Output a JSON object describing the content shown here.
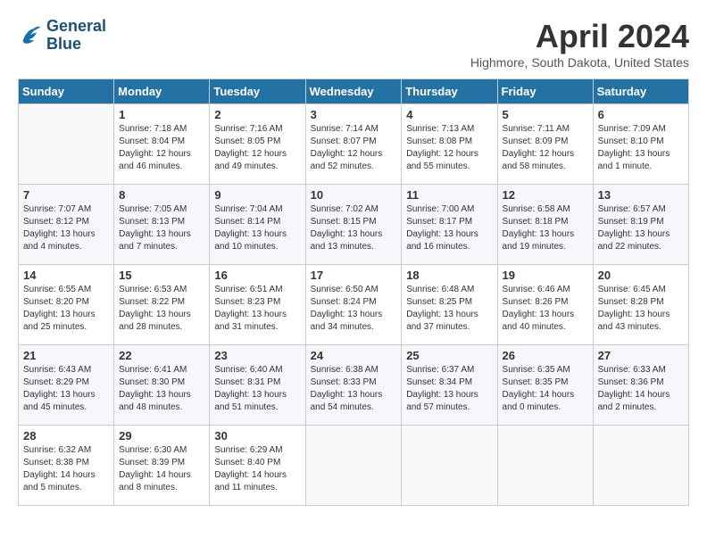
{
  "header": {
    "logo_line1": "General",
    "logo_line2": "Blue",
    "month_title": "April 2024",
    "subtitle": "Highmore, South Dakota, United States"
  },
  "weekdays": [
    "Sunday",
    "Monday",
    "Tuesday",
    "Wednesday",
    "Thursday",
    "Friday",
    "Saturday"
  ],
  "weeks": [
    [
      {
        "day": "",
        "info": ""
      },
      {
        "day": "1",
        "info": "Sunrise: 7:18 AM\nSunset: 8:04 PM\nDaylight: 12 hours\nand 46 minutes."
      },
      {
        "day": "2",
        "info": "Sunrise: 7:16 AM\nSunset: 8:05 PM\nDaylight: 12 hours\nand 49 minutes."
      },
      {
        "day": "3",
        "info": "Sunrise: 7:14 AM\nSunset: 8:07 PM\nDaylight: 12 hours\nand 52 minutes."
      },
      {
        "day": "4",
        "info": "Sunrise: 7:13 AM\nSunset: 8:08 PM\nDaylight: 12 hours\nand 55 minutes."
      },
      {
        "day": "5",
        "info": "Sunrise: 7:11 AM\nSunset: 8:09 PM\nDaylight: 12 hours\nand 58 minutes."
      },
      {
        "day": "6",
        "info": "Sunrise: 7:09 AM\nSunset: 8:10 PM\nDaylight: 13 hours\nand 1 minute."
      }
    ],
    [
      {
        "day": "7",
        "info": "Sunrise: 7:07 AM\nSunset: 8:12 PM\nDaylight: 13 hours\nand 4 minutes."
      },
      {
        "day": "8",
        "info": "Sunrise: 7:05 AM\nSunset: 8:13 PM\nDaylight: 13 hours\nand 7 minutes."
      },
      {
        "day": "9",
        "info": "Sunrise: 7:04 AM\nSunset: 8:14 PM\nDaylight: 13 hours\nand 10 minutes."
      },
      {
        "day": "10",
        "info": "Sunrise: 7:02 AM\nSunset: 8:15 PM\nDaylight: 13 hours\nand 13 minutes."
      },
      {
        "day": "11",
        "info": "Sunrise: 7:00 AM\nSunset: 8:17 PM\nDaylight: 13 hours\nand 16 minutes."
      },
      {
        "day": "12",
        "info": "Sunrise: 6:58 AM\nSunset: 8:18 PM\nDaylight: 13 hours\nand 19 minutes."
      },
      {
        "day": "13",
        "info": "Sunrise: 6:57 AM\nSunset: 8:19 PM\nDaylight: 13 hours\nand 22 minutes."
      }
    ],
    [
      {
        "day": "14",
        "info": "Sunrise: 6:55 AM\nSunset: 8:20 PM\nDaylight: 13 hours\nand 25 minutes."
      },
      {
        "day": "15",
        "info": "Sunrise: 6:53 AM\nSunset: 8:22 PM\nDaylight: 13 hours\nand 28 minutes."
      },
      {
        "day": "16",
        "info": "Sunrise: 6:51 AM\nSunset: 8:23 PM\nDaylight: 13 hours\nand 31 minutes."
      },
      {
        "day": "17",
        "info": "Sunrise: 6:50 AM\nSunset: 8:24 PM\nDaylight: 13 hours\nand 34 minutes."
      },
      {
        "day": "18",
        "info": "Sunrise: 6:48 AM\nSunset: 8:25 PM\nDaylight: 13 hours\nand 37 minutes."
      },
      {
        "day": "19",
        "info": "Sunrise: 6:46 AM\nSunset: 8:26 PM\nDaylight: 13 hours\nand 40 minutes."
      },
      {
        "day": "20",
        "info": "Sunrise: 6:45 AM\nSunset: 8:28 PM\nDaylight: 13 hours\nand 43 minutes."
      }
    ],
    [
      {
        "day": "21",
        "info": "Sunrise: 6:43 AM\nSunset: 8:29 PM\nDaylight: 13 hours\nand 45 minutes."
      },
      {
        "day": "22",
        "info": "Sunrise: 6:41 AM\nSunset: 8:30 PM\nDaylight: 13 hours\nand 48 minutes."
      },
      {
        "day": "23",
        "info": "Sunrise: 6:40 AM\nSunset: 8:31 PM\nDaylight: 13 hours\nand 51 minutes."
      },
      {
        "day": "24",
        "info": "Sunrise: 6:38 AM\nSunset: 8:33 PM\nDaylight: 13 hours\nand 54 minutes."
      },
      {
        "day": "25",
        "info": "Sunrise: 6:37 AM\nSunset: 8:34 PM\nDaylight: 13 hours\nand 57 minutes."
      },
      {
        "day": "26",
        "info": "Sunrise: 6:35 AM\nSunset: 8:35 PM\nDaylight: 14 hours\nand 0 minutes."
      },
      {
        "day": "27",
        "info": "Sunrise: 6:33 AM\nSunset: 8:36 PM\nDaylight: 14 hours\nand 2 minutes."
      }
    ],
    [
      {
        "day": "28",
        "info": "Sunrise: 6:32 AM\nSunset: 8:38 PM\nDaylight: 14 hours\nand 5 minutes."
      },
      {
        "day": "29",
        "info": "Sunrise: 6:30 AM\nSunset: 8:39 PM\nDaylight: 14 hours\nand 8 minutes."
      },
      {
        "day": "30",
        "info": "Sunrise: 6:29 AM\nSunset: 8:40 PM\nDaylight: 14 hours\nand 11 minutes."
      },
      {
        "day": "",
        "info": ""
      },
      {
        "day": "",
        "info": ""
      },
      {
        "day": "",
        "info": ""
      },
      {
        "day": "",
        "info": ""
      }
    ]
  ]
}
